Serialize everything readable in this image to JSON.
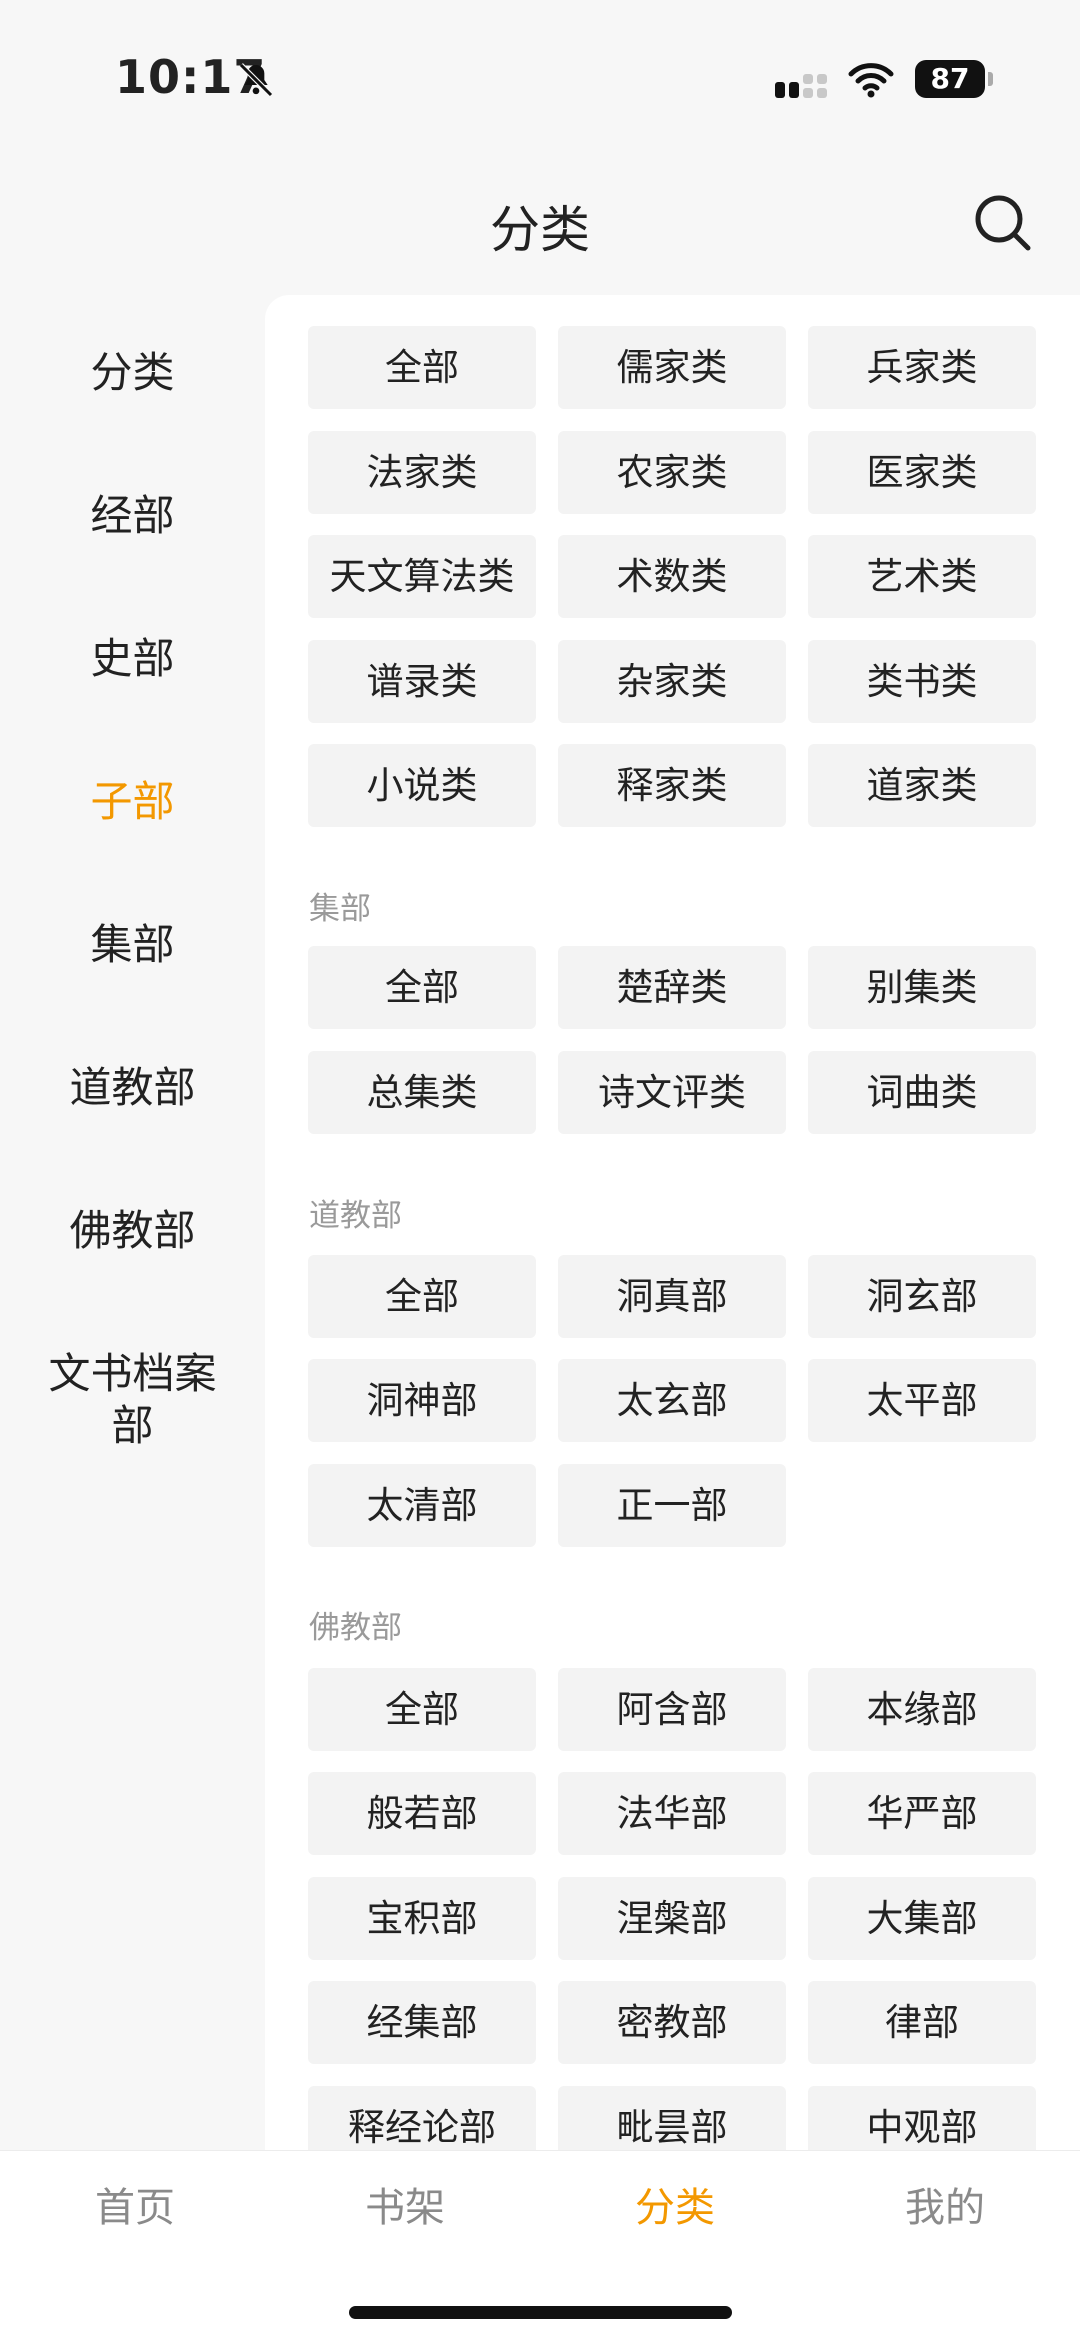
{
  "status_bar": {
    "time": "10:17",
    "battery": "87"
  },
  "header": {
    "title": "分类"
  },
  "sidebar": {
    "items": [
      {
        "label": "分类"
      },
      {
        "label": "经部"
      },
      {
        "label": "史部"
      },
      {
        "label": "子部",
        "active": true
      },
      {
        "label": "集部"
      },
      {
        "label": "道教部"
      },
      {
        "label": "佛教部"
      },
      {
        "label": "文书档案部"
      }
    ]
  },
  "sections": {
    "zibu": {
      "chips": [
        "全部",
        "儒家类",
        "兵家类",
        "法家类",
        "农家类",
        "医家类",
        "天文算法类",
        "术数类",
        "艺术类",
        "谱录类",
        "杂家类",
        "类书类",
        "小说类",
        "释家类",
        "道家类"
      ]
    },
    "jibu": {
      "label": "集部",
      "chips": [
        "全部",
        "楚辞类",
        "别集类",
        "总集类",
        "诗文评类",
        "词曲类"
      ]
    },
    "daojiao": {
      "label": "道教部",
      "chips": [
        "全部",
        "洞真部",
        "洞玄部",
        "洞神部",
        "太玄部",
        "太平部",
        "太清部",
        "正一部"
      ]
    },
    "fojiao": {
      "label": "佛教部",
      "chips": [
        "全部",
        "阿含部",
        "本缘部",
        "般若部",
        "法华部",
        "华严部",
        "宝积部",
        "涅槃部",
        "大集部",
        "经集部",
        "密教部",
        "律部",
        "释经论部",
        "毗昙部",
        "中观部"
      ]
    }
  },
  "tabbar": {
    "tabs": [
      {
        "label": "首页"
      },
      {
        "label": "书架"
      },
      {
        "label": "分类",
        "active": true
      },
      {
        "label": "我的"
      }
    ]
  },
  "colors": {
    "accent": "#f39800",
    "chip_bg": "#f3f3f3",
    "section_label": "#9a9a9a"
  }
}
